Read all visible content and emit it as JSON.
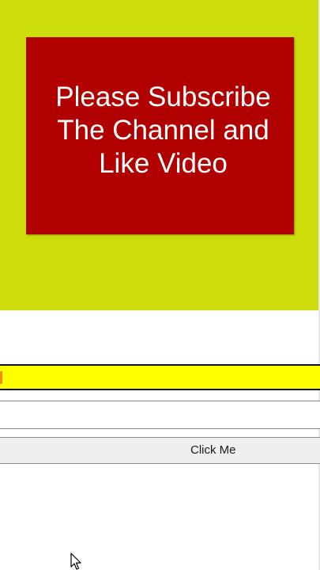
{
  "banner": {
    "message": "Please Subscribe The Channel and Like Video"
  },
  "text_input": {
    "value": "",
    "placeholder": ""
  },
  "button": {
    "label": "Click Me"
  },
  "colors": {
    "banner_background": "#cddc0b",
    "card_background": "#b00000",
    "highlight_bar": "#ffff00"
  }
}
